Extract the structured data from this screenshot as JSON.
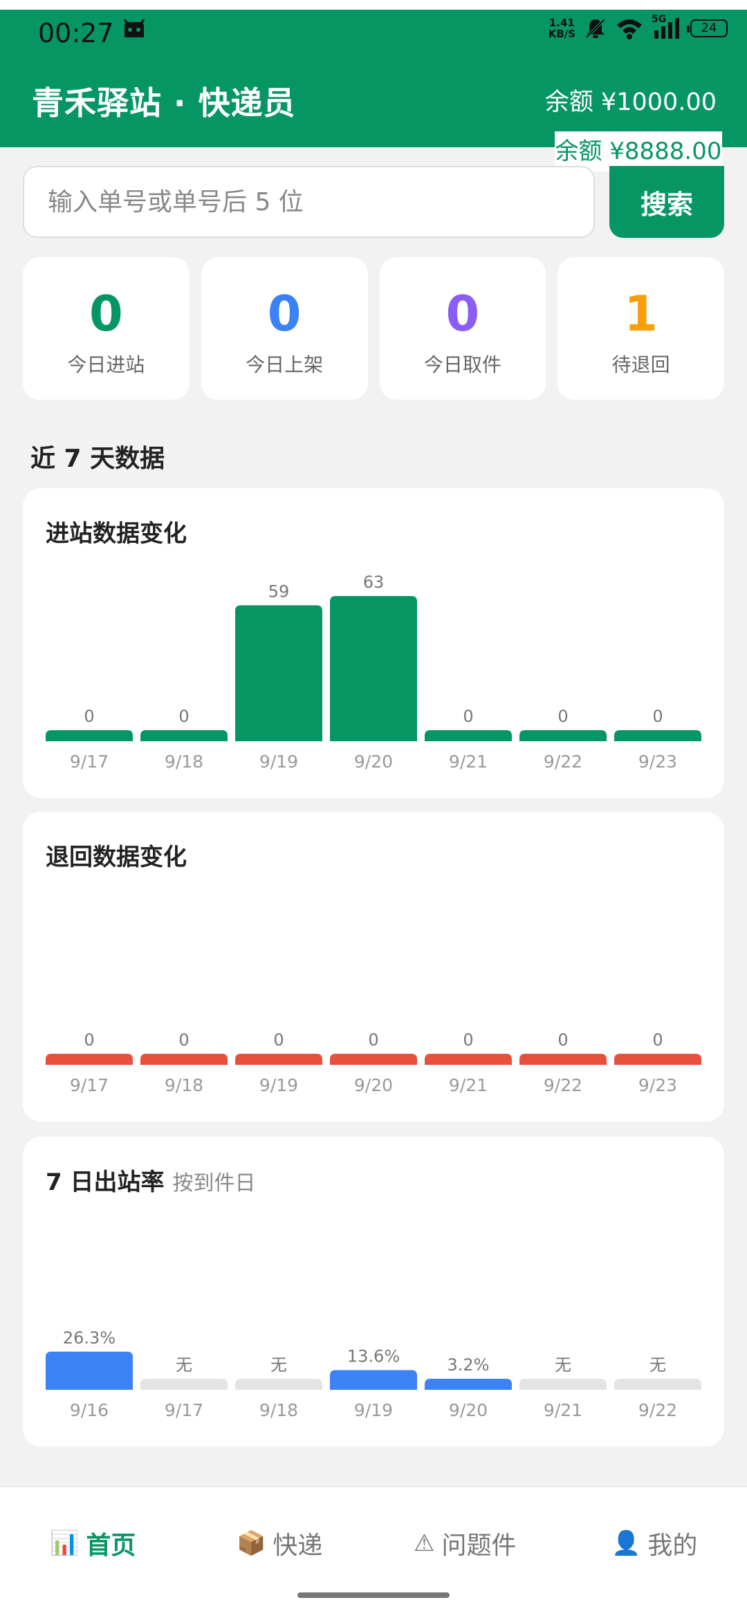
{
  "status_bar": {
    "time": "00:27",
    "netspeed_top": "1.41",
    "netspeed_bottom": "KB/S",
    "signal_label": "5G",
    "battery": "24"
  },
  "header": {
    "title": "青禾驿站 · 快递员",
    "balance": "余额 ¥1000.00",
    "overlay_balance": "余额 ¥8888.00"
  },
  "search": {
    "placeholder": "输入单号或单号后 5 位",
    "button_label": "搜索"
  },
  "stats": [
    {
      "value": "0",
      "label": "今日进站",
      "color": "#069664"
    },
    {
      "value": "0",
      "label": "今日上架",
      "color": "#3b82f6"
    },
    {
      "value": "0",
      "label": "今日取件",
      "color": "#8b5cf6"
    },
    {
      "value": "1",
      "label": "待退回",
      "color": "#f5a00b"
    }
  ],
  "section_title": "近 7 天数据",
  "colors": {
    "brand": "#069664",
    "return": "#e8503e",
    "rate": "#3b82f6",
    "empty": "#e4e4e4"
  },
  "chart_data": [
    {
      "type": "bar",
      "title": "进站数据变化",
      "categories": [
        "9/17",
        "9/18",
        "9/19",
        "9/20",
        "9/21",
        "9/22",
        "9/23"
      ],
      "values": [
        0,
        0,
        59,
        63,
        0,
        0,
        0
      ],
      "labels": [
        "0",
        "0",
        "59",
        "63",
        "0",
        "0",
        "0"
      ]
    },
    {
      "type": "bar",
      "title": "退回数据变化",
      "categories": [
        "9/17",
        "9/18",
        "9/19",
        "9/20",
        "9/21",
        "9/22",
        "9/23"
      ],
      "values": [
        0,
        0,
        0,
        0,
        0,
        0,
        0
      ],
      "labels": [
        "0",
        "0",
        "0",
        "0",
        "0",
        "0",
        "0"
      ]
    },
    {
      "type": "bar",
      "title": "7 日出站率",
      "subtitle": "按到件日",
      "categories": [
        "9/16",
        "9/17",
        "9/18",
        "9/19",
        "9/20",
        "9/21",
        "9/22"
      ],
      "values": [
        26.3,
        null,
        null,
        13.6,
        3.2,
        null,
        null
      ],
      "labels": [
        "26.3%",
        "无",
        "无",
        "13.6%",
        "3.2%",
        "无",
        "无"
      ]
    }
  ],
  "nav": [
    {
      "icon": "📊",
      "label": "首页",
      "active": true
    },
    {
      "icon": "📦",
      "label": "快递",
      "active": false
    },
    {
      "icon": "⚠",
      "label": "问题件",
      "active": false
    },
    {
      "icon": "👤",
      "label": "我的",
      "active": false
    }
  ]
}
